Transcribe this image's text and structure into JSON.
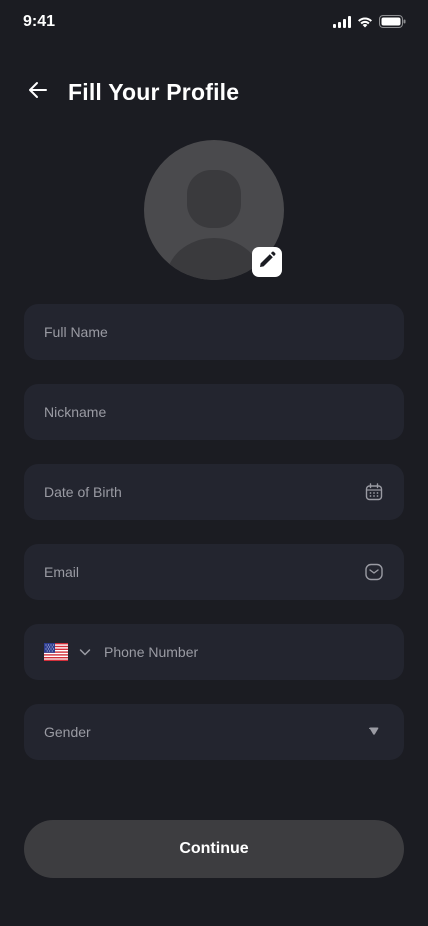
{
  "status_bar": {
    "time": "9:41",
    "icons": [
      "signal-icon",
      "wifi-icon",
      "battery-icon"
    ]
  },
  "header": {
    "back_icon": "arrow-left-icon",
    "title": "Fill Your Profile"
  },
  "avatar": {
    "icon": "user-placeholder-icon",
    "edit_icon": "pencil-icon"
  },
  "form": {
    "full_name": {
      "placeholder": "Full Name"
    },
    "nickname": {
      "placeholder": "Nickname"
    },
    "date_of_birth": {
      "placeholder": "Date of Birth",
      "icon": "calendar-icon"
    },
    "email": {
      "placeholder": "Email",
      "icon": "mail-icon"
    },
    "phone": {
      "placeholder": "Phone Number",
      "country_flag": "us-flag-icon",
      "chevron_icon": "chevron-down-icon"
    },
    "gender": {
      "placeholder": "Gender",
      "icon": "caret-down-icon"
    }
  },
  "continue_button": {
    "label": "Continue"
  },
  "colors": {
    "background": "#1b1c22",
    "field_background": "#23252f",
    "placeholder_text": "#9a9ba3",
    "button_background": "#3d3d40",
    "avatar_background": "#4a4a4d"
  }
}
